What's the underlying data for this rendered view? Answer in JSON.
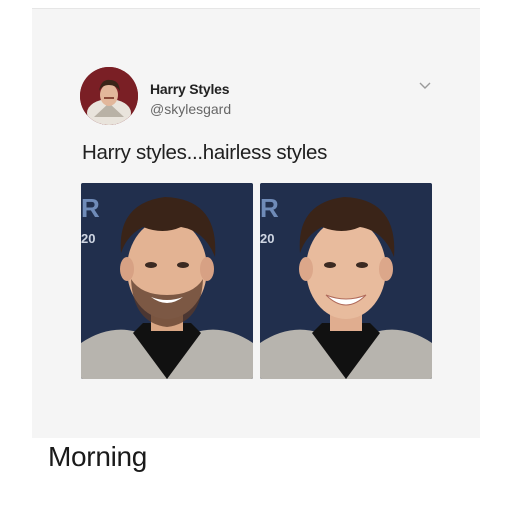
{
  "tweet": {
    "author_name": "Harry Styles",
    "author_handle": "@skylesgard",
    "text": "Harry styles...hairless styles",
    "menu_icon": "chevron-down-icon",
    "photos": [
      {
        "description": "bearded-portrait",
        "backdrop_text": "R",
        "backdrop_number": "20"
      },
      {
        "description": "clean-shaven-portrait",
        "backdrop_text": "R",
        "backdrop_number": "20"
      }
    ]
  },
  "caption": "Morning",
  "colors": {
    "card_background": "#f5f5f5",
    "photo_backdrop": "#1d2a44",
    "avatar_background": "#7a1f25"
  }
}
